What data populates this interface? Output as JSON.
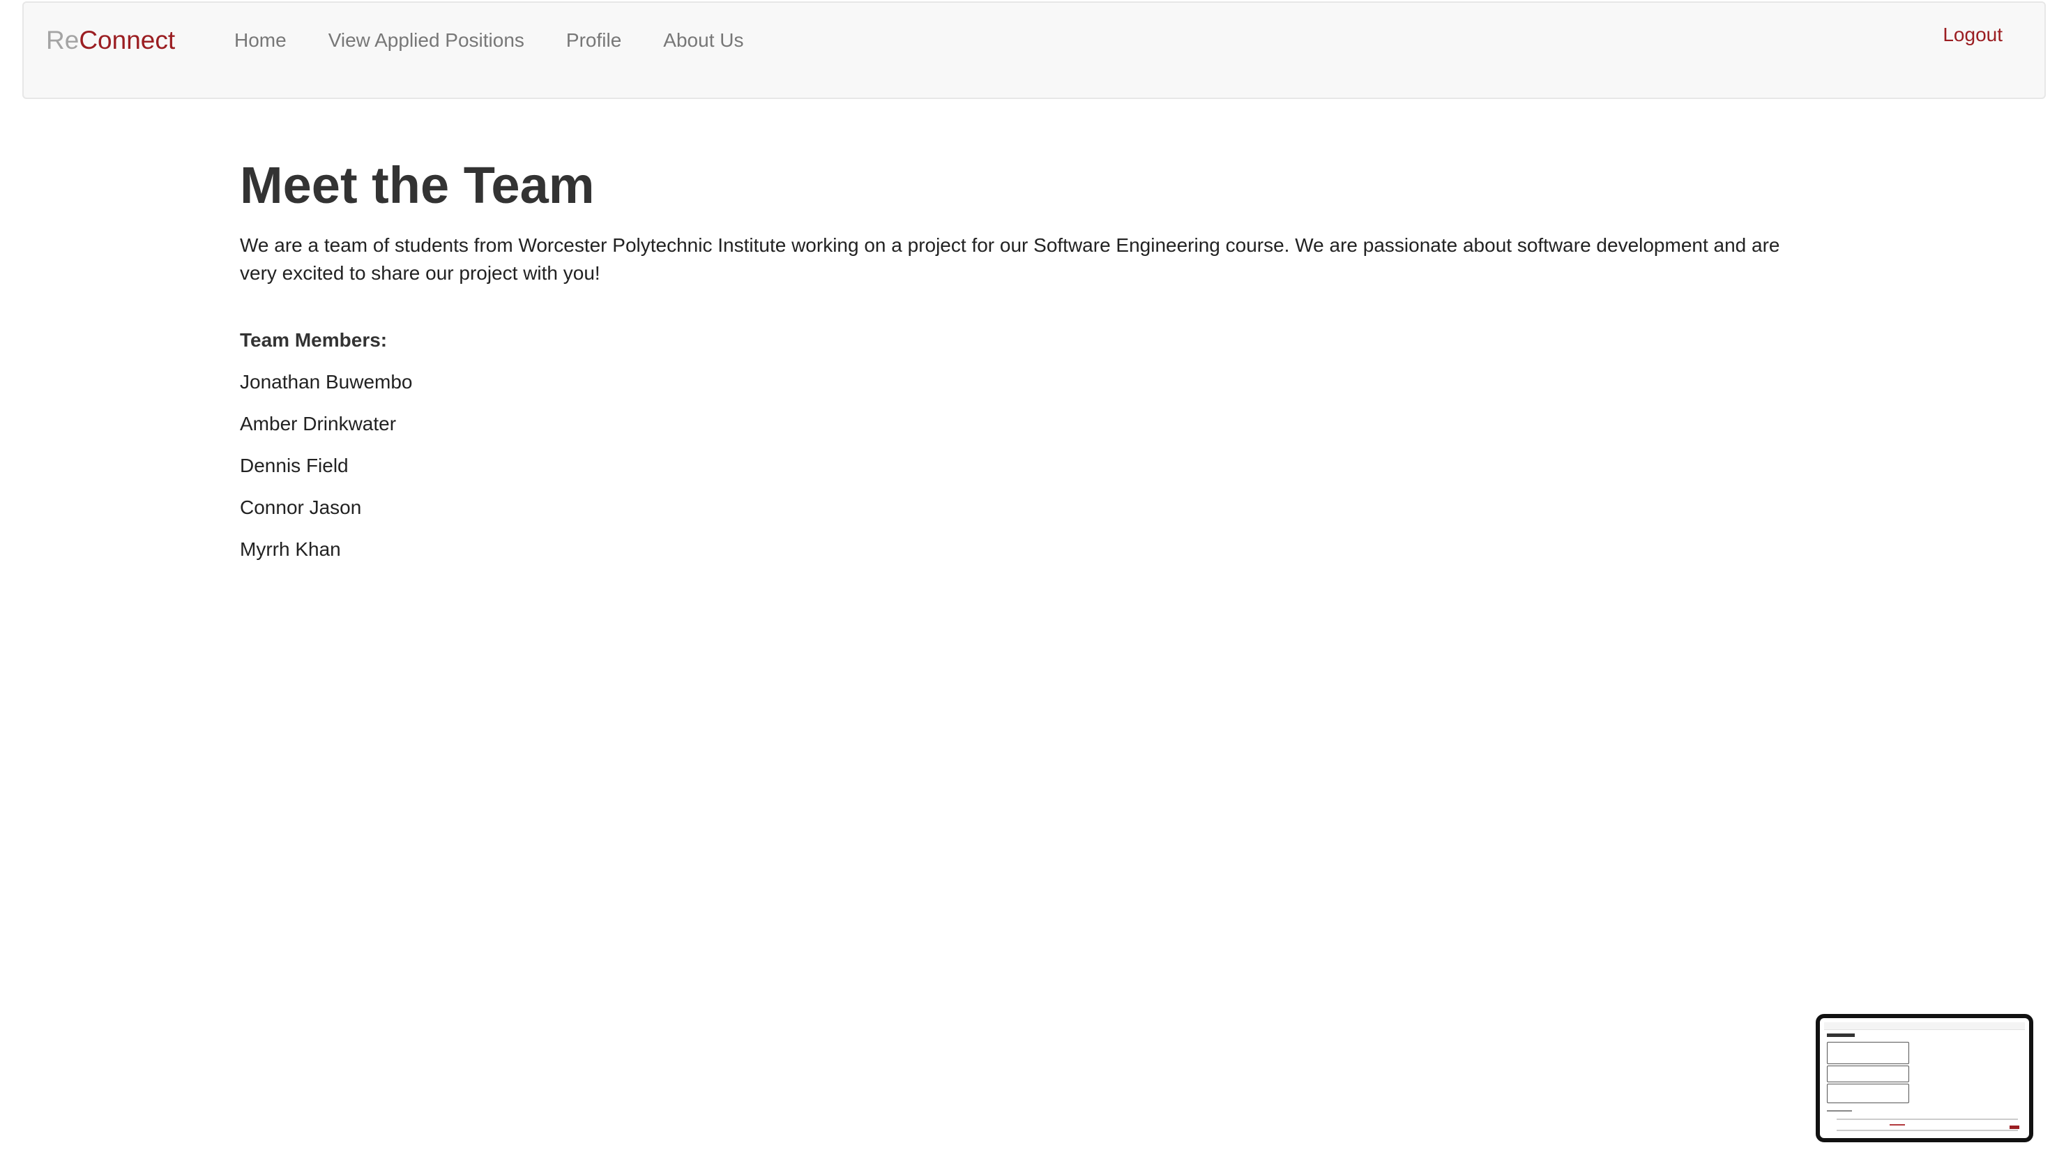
{
  "navbar": {
    "brand_prefix": "Re",
    "brand_suffix": "Connect",
    "links": [
      {
        "label": "Home"
      },
      {
        "label": "View Applied Positions"
      },
      {
        "label": "Profile"
      },
      {
        "label": "About Us"
      }
    ],
    "logout_label": "Logout"
  },
  "main": {
    "title": "Meet the Team",
    "intro": "We are a team of students from Worcester Polytechnic Institute working on a project for our Software Engineering course. We are passionate about software development and are very excited to share our project with you!",
    "members_heading": "Team Members:",
    "members": [
      {
        "name": "Jonathan Buwembo"
      },
      {
        "name": "Amber Drinkwater"
      },
      {
        "name": "Dennis Field"
      },
      {
        "name": "Connor Jason"
      },
      {
        "name": "Myrrh Khan"
      }
    ]
  },
  "colors": {
    "brand_red": "#9b1e22",
    "brand_gray": "#a4a4a4",
    "nav_link": "#777777",
    "navbar_bg": "#f8f8f8"
  }
}
